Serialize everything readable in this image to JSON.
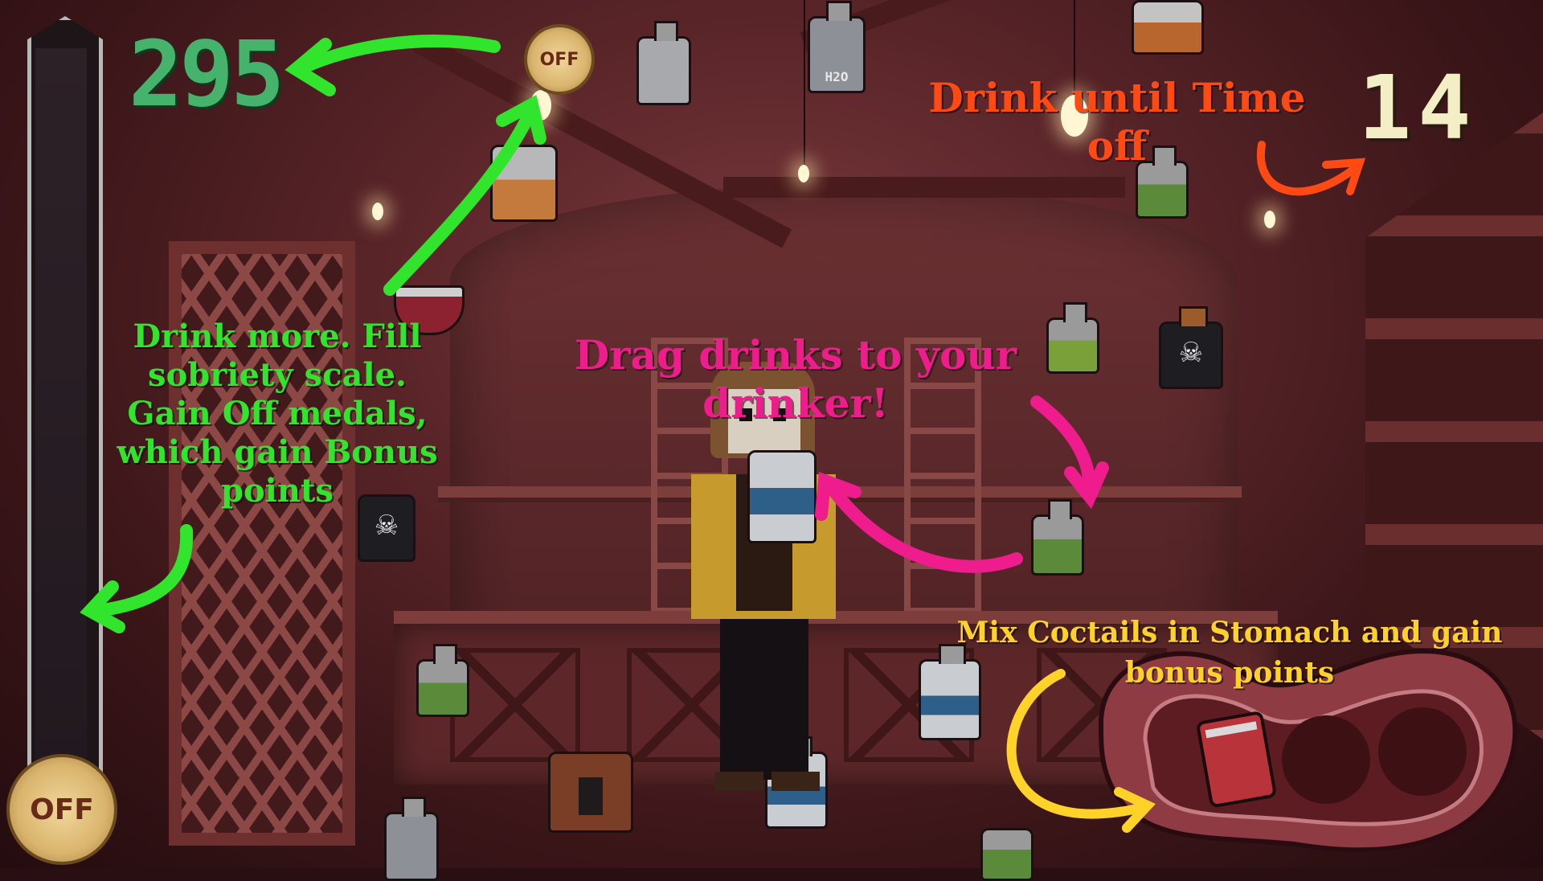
{
  "hud": {
    "score": "295",
    "timer": "14",
    "off_medal_label": "OFF",
    "scale_medal_label": "OFF"
  },
  "tutorial": {
    "sobriety_hint": "Drink more. Fill sobriety scale. Gain Off medals, which gain Bonus points",
    "drag_hint": "Drag drinks to your drinker!",
    "timer_hint": "Drink until Time off",
    "stomach_hint": "Mix Coctails in Stomach and gain bonus points"
  },
  "drinks": {
    "water_label": "H2O"
  },
  "colors": {
    "score": "#45b36b",
    "timer": "#f3eec5",
    "hint_green": "#31e52c",
    "hint_pink": "#ee1c8c",
    "hint_red": "#ff4a14",
    "hint_yellow": "#ffd22a",
    "medal": "#d9b46d"
  },
  "icons": {
    "medal": "off-medal-icon",
    "skull": "skull-icon",
    "can": "soda-can-icon"
  }
}
